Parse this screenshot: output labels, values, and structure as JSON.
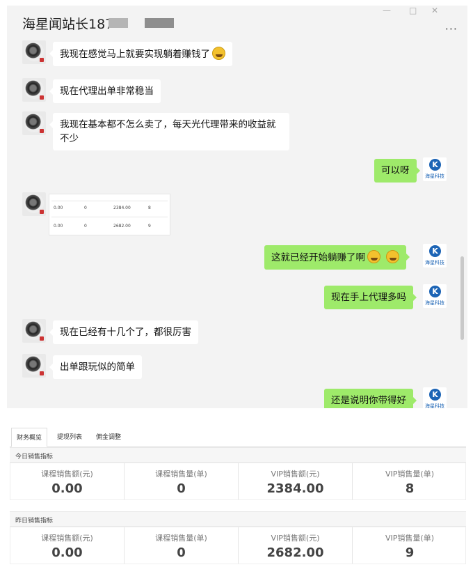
{
  "chat": {
    "title": "海星闻站长187",
    "window_controls": [
      "—",
      "□",
      "✕"
    ],
    "more": "···",
    "messages": [
      {
        "side": "in",
        "text": "我现在感觉马上就要实现躺着赚钱了",
        "emoji": 1
      },
      {
        "side": "in",
        "text": "现在代理出单非常稳当"
      },
      {
        "side": "in",
        "text": "我现在基本都不怎么卖了，每天光代理带来的收益就不少"
      },
      {
        "side": "out",
        "text": "可以呀"
      },
      {
        "side": "in",
        "type": "image"
      },
      {
        "side": "out",
        "text": "这就已经开始躺赚了啊",
        "emoji": 2
      },
      {
        "side": "out",
        "text": "现在手上代理多吗"
      },
      {
        "side": "in",
        "text": "现在已经有十几个了，都很厉害"
      },
      {
        "side": "in",
        "text": "出单跟玩似的简单"
      },
      {
        "side": "out",
        "text": "还是说明你带得好"
      }
    ],
    "right_avatar_brand": "海星科技",
    "right_avatar_logo": "K",
    "thumb": {
      "row1": [
        "0.00",
        "0",
        "2384.00",
        "8"
      ],
      "row2": [
        "0.00",
        "0",
        "2682.00",
        "9"
      ]
    }
  },
  "finance": {
    "tabs": [
      "财务概览",
      "提现列表",
      "佣金调整"
    ],
    "active_tab": 0,
    "sections": [
      {
        "title": "今日销售指标",
        "stats": [
          {
            "label": "课程销售额(元)",
            "value": "0.00"
          },
          {
            "label": "课程销售量(单)",
            "value": "0"
          },
          {
            "label": "VIP销售额(元)",
            "value": "2384.00"
          },
          {
            "label": "VIP销售量(单)",
            "value": "8"
          }
        ]
      },
      {
        "title": "昨日销售指标",
        "stats": [
          {
            "label": "课程销售额(元)",
            "value": "0.00"
          },
          {
            "label": "课程销售量(单)",
            "value": "0"
          },
          {
            "label": "VIP销售额(元)",
            "value": "2682.00"
          },
          {
            "label": "VIP销售量(单)",
            "value": "9"
          }
        ]
      }
    ]
  }
}
